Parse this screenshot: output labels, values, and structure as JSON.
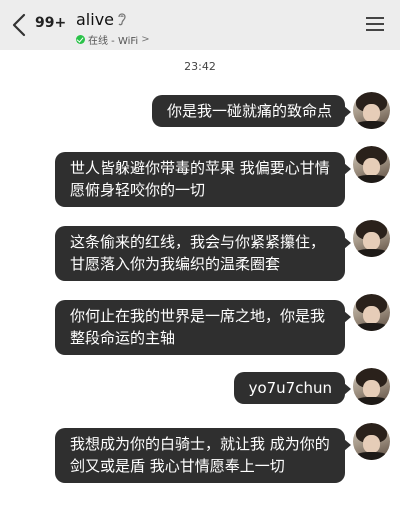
{
  "header": {
    "back_icon": "chevron-left-icon",
    "unread_count": "99+",
    "contact_name": "alive",
    "ear_icon": "ear-icon",
    "status_text": "在线 - WiFi",
    "status_chevron": ">",
    "menu_icon": "hamburger-menu-icon"
  },
  "chat": {
    "timestamp": "23:42",
    "messages": [
      {
        "text": "你是我一碰就痛的致命点"
      },
      {
        "text": "世人皆躲避你带毒的苹果 我偏要心甘情愿俯身轻咬你的一切"
      },
      {
        "text": "这条偷来的红线，我会与你紧紧攥住，甘愿落入你为我编织的温柔圈套"
      },
      {
        "text": "你何止在我的世界是一席之地，你是我整段命运的主轴"
      },
      {
        "text": "yo7u7chun"
      },
      {
        "text": "我想成为你的白骑士，就让我 成为你的剑又或是盾 我心甘情愿奉上一切"
      }
    ]
  },
  "colors": {
    "header_bg": "#ededed",
    "bubble_bg": "#2f2f2f",
    "bubble_text": "#ffffff",
    "online_green": "#29c248"
  }
}
